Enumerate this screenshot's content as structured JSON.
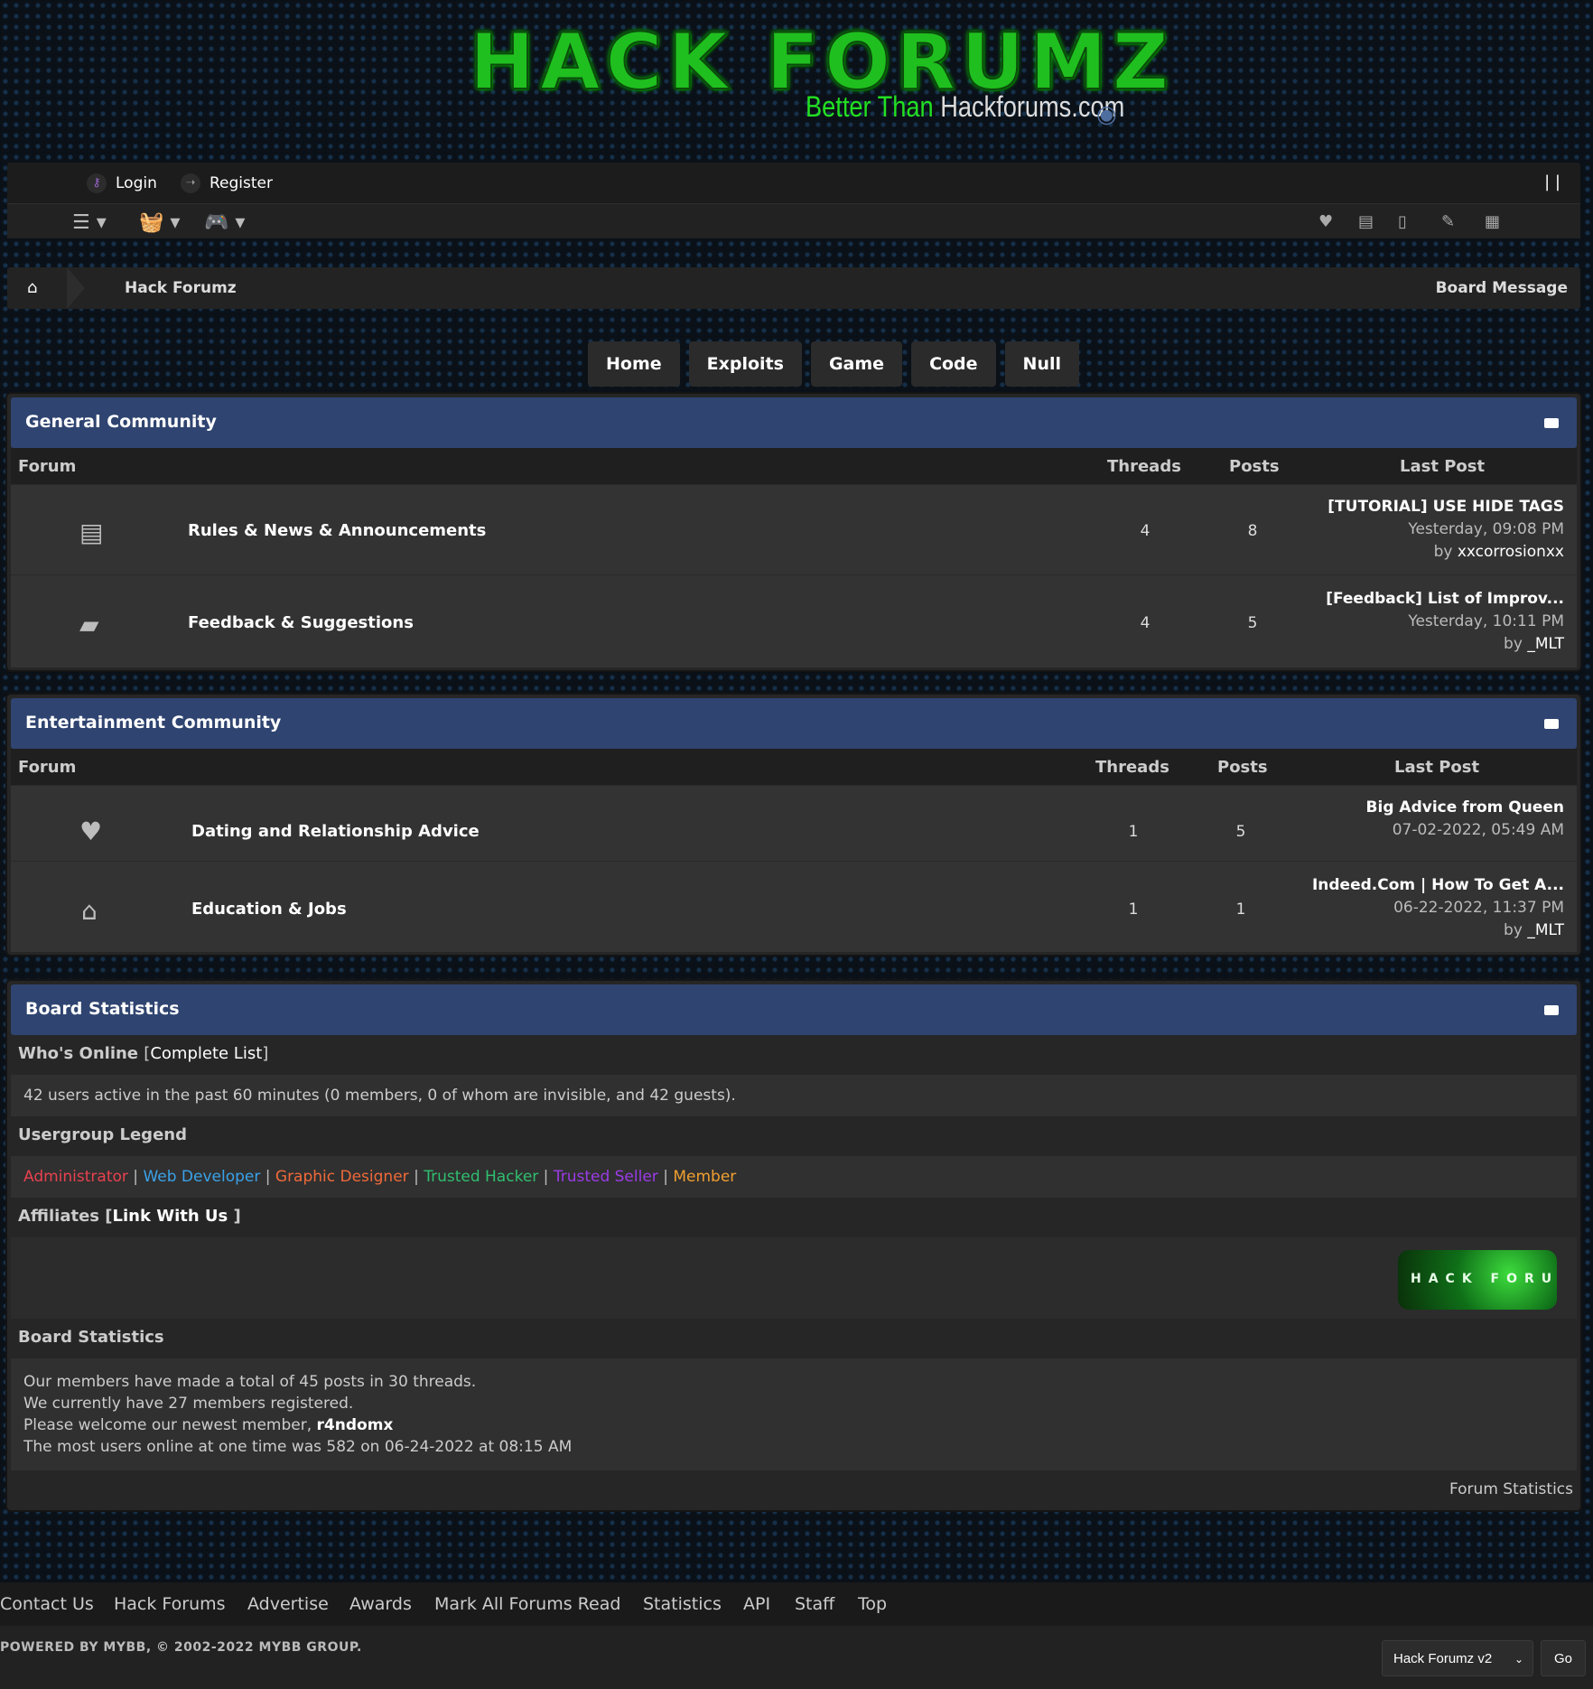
{
  "logo": {
    "title": "HACK FORUMZ",
    "sub_green": "Better Than ",
    "sub_white": "Hackforums.com"
  },
  "topbar": {
    "login": "Login",
    "register": "Register",
    "right_text": "| |"
  },
  "breadcrumb": {
    "title": "Hack Forumz",
    "board_message": "Board Message"
  },
  "nav": [
    {
      "label": "Home"
    },
    {
      "label": "Exploits"
    },
    {
      "label": "Game"
    },
    {
      "label": "Code"
    },
    {
      "label": "Null"
    }
  ],
  "columns": {
    "forum": "Forum",
    "threads": "Threads",
    "posts": "Posts",
    "last_post": "Last Post"
  },
  "general": {
    "title": "General Community",
    "forums": [
      {
        "name": "Rules & News & Announcements",
        "threads": "4",
        "posts": "8",
        "lp_title": "[TUTORIAL] USE HIDE TAGS",
        "lp_date": "Yesterday, 09:08 PM",
        "lp_by": "by ",
        "lp_user": "xxcorrosionxx"
      },
      {
        "name": "Feedback & Suggestions",
        "threads": "4",
        "posts": "5",
        "lp_title": "[Feedback] List of Improv...",
        "lp_date": "Yesterday, 10:11 PM",
        "lp_by": "by ",
        "lp_user": "_MLT"
      }
    ]
  },
  "entertainment": {
    "title": "Entertainment Community",
    "forums": [
      {
        "name": "Dating and Relationship Advice",
        "threads": "1",
        "posts": "5",
        "lp_title": "Big Advice from Queen",
        "lp_date": "07-02-2022, 05:49 AM"
      },
      {
        "name": "Education & Jobs",
        "threads": "1",
        "posts": "1",
        "lp_title": "Indeed.Com | How To Get A...",
        "lp_date": "06-22-2022, 11:37 PM",
        "lp_by": "by ",
        "lp_user": "_MLT"
      }
    ]
  },
  "stats": {
    "title": "Board Statistics",
    "whos_online": "Who's Online",
    "complete_list": "Complete List",
    "online_text": "42 users active in the past 60 minutes (0 members, 0 of whom are invisible, and 42 guests).",
    "legend_title": "Usergroup Legend",
    "legend": [
      {
        "label": "Administrator",
        "color": "#e8414f"
      },
      {
        "label": "Web Developer",
        "color": "#3aa2e8"
      },
      {
        "label": "Graphic Designer",
        "color": "#f06a3a"
      },
      {
        "label": "Trusted Hacker",
        "color": "#2fbf6f"
      },
      {
        "label": "Trusted Seller",
        "color": "#9b3be6"
      },
      {
        "label": "Member",
        "color": "#f0a030"
      }
    ],
    "affiliates": "Affiliates",
    "link_with_us": "Link With Us",
    "affiliate_banner": "HACK FORUMZ",
    "stats_title": "Board Statistics",
    "line1": "Our members have made a total of 45 posts in 30 threads.",
    "line2": "We currently have 27 members registered.",
    "line3_prefix": "Please welcome our newest member, ",
    "newest_member": "r4ndomx",
    "line4": "The most users online at one time was 582 on 06-24-2022 at 08:15 AM",
    "forum_statistics": "Forum Statistics"
  },
  "footer": {
    "links": [
      "Contact Us",
      "Hack Forums",
      "Advertise",
      "Awards",
      "Mark All Forums Read",
      "Statistics",
      "API",
      "Staff",
      "Top"
    ],
    "powered": "POWERED BY MYBB, © 2002-2022 MYBB GROUP.",
    "theme": "Hack Forumz v2",
    "go": "Go"
  },
  "colors": {
    "header_blue": "#2f4470",
    "logo_green": "#1fbf1f"
  }
}
